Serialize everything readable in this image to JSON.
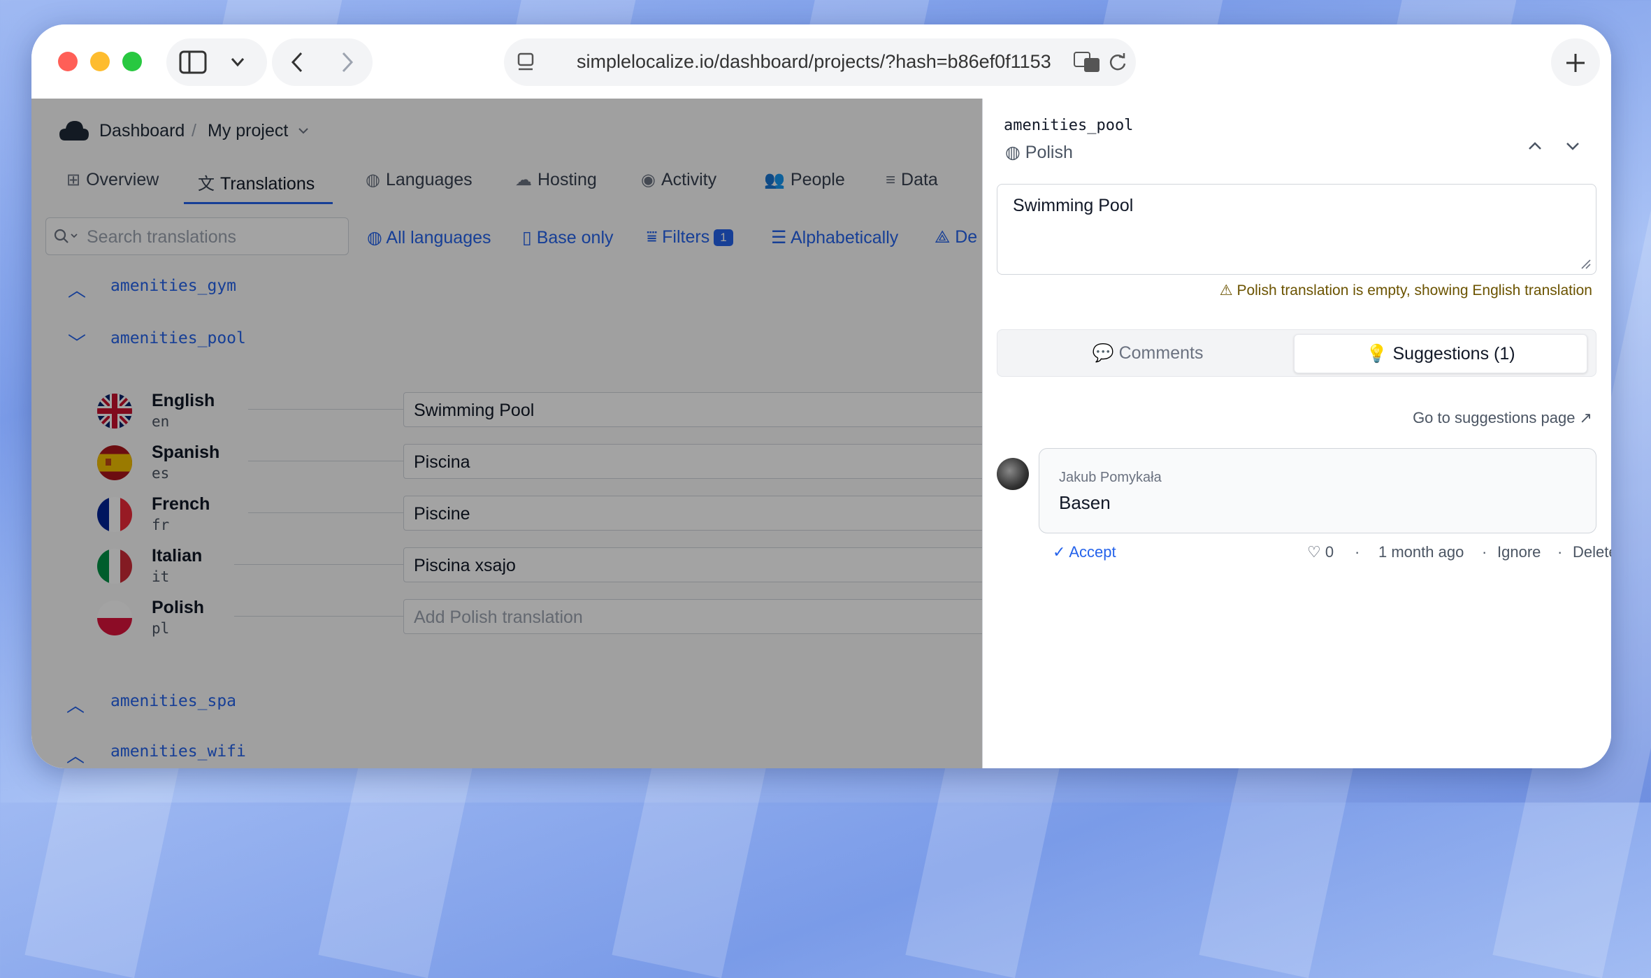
{
  "browser": {
    "url": "simplelocalize.io/dashboard/projects/?hash=b86ef0f1153",
    "colors": {
      "close": "#ff5f57",
      "minimize": "#febc2e",
      "maximize": "#28c840"
    }
  },
  "breadcrumb": {
    "home": "Dashboard",
    "separator": "/",
    "project": "My project"
  },
  "tabs": [
    {
      "label": "Overview",
      "icon": "grid-icon"
    },
    {
      "label": "Translations",
      "icon": "translate-icon"
    },
    {
      "label": "Languages",
      "icon": "globe-icon"
    },
    {
      "label": "Hosting",
      "icon": "cloud-icon"
    },
    {
      "label": "Activity",
      "icon": "broadcast-icon"
    },
    {
      "label": "People",
      "icon": "people-icon"
    },
    {
      "label": "Data",
      "icon": "database-icon"
    }
  ],
  "toolbar": {
    "search_placeholder": "Search translations",
    "all_languages": "All languages",
    "base_only": "Base only",
    "filters": "Filters",
    "filters_count": "1",
    "sort": "Alphabetically",
    "more": "De"
  },
  "keys": {
    "gym": "amenities_gym",
    "pool": "amenities_pool",
    "spa": "amenities_spa",
    "wifi": "amenities_wifi"
  },
  "languages": [
    {
      "name": "English",
      "code": "en",
      "value": "Swimming Pool"
    },
    {
      "name": "Spanish",
      "code": "es",
      "value": "Piscina"
    },
    {
      "name": "French",
      "code": "fr",
      "value": "Piscine"
    },
    {
      "name": "Italian",
      "code": "it",
      "value": "Piscina xsajo"
    },
    {
      "name": "Polish",
      "code": "pl",
      "placeholder": "Add Polish translation"
    }
  ],
  "panel": {
    "key": "amenities_pool",
    "language": "Polish",
    "textarea_value": "Swimming Pool",
    "warning": "Polish translation is empty, showing English translation",
    "tab_comments": "Comments",
    "tab_suggestions": "Suggestions (1)",
    "goto": "Go to suggestions page ↗",
    "suggestion": {
      "author": "Jakub Pomykała",
      "text": "Basen",
      "accept": "Accept",
      "likes": "0",
      "dot": "·",
      "time": "1 month ago",
      "ignore": "Ignore",
      "delete": "Delete"
    }
  }
}
